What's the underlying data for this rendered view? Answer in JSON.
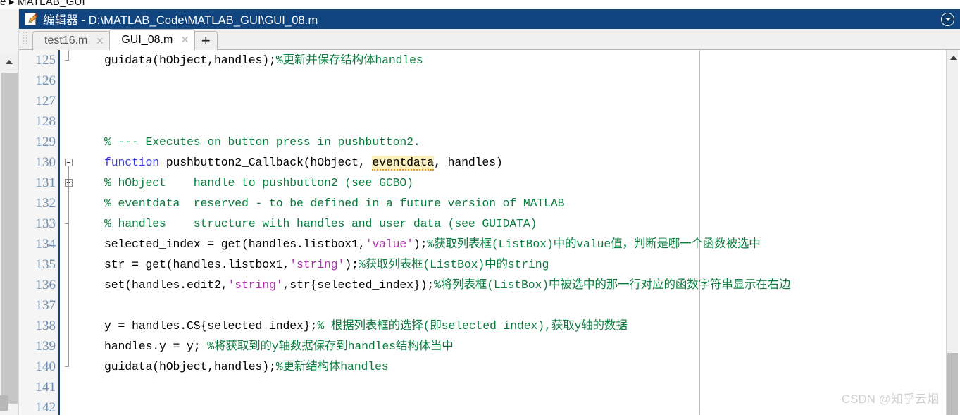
{
  "breadcrumb": {
    "text": "e ▸ MATLAB_GUI"
  },
  "window": {
    "title": "编辑器 - D:\\MATLAB_Code\\MATLAB_GUI\\GUI_08.m",
    "icon": "editor-pencil-icon",
    "dropdown_icon": "chevron-down-circle-icon",
    "titlebar_color": "#11457f"
  },
  "tabs": {
    "items": [
      {
        "label": "test16.m",
        "active": false,
        "close_icon": "✕"
      },
      {
        "label": "GUI_08.m",
        "active": true,
        "close_icon": "✕"
      }
    ],
    "new_tab_label": "+"
  },
  "editor": {
    "first_line_number": 125,
    "column_guide_column": 75,
    "colors": {
      "comment": "#0a7c3d",
      "keyword": "#3d3df5",
      "string": "#b033b0",
      "plain": "#000000",
      "warning_highlight": "#fdf0c0",
      "warning_underline": "#e09a20",
      "linenumber": "#6d8fb5",
      "gutter_bg": "#f5f5f5",
      "gutter_border": "#16487f"
    },
    "lines": [
      {
        "n": 125,
        "fold": "end",
        "tokens": [
          {
            "t": "guidata(hObject,handles);",
            "c": "plain"
          },
          {
            "t": "%更新并保存结构体handles",
            "c": "comment"
          }
        ]
      },
      {
        "n": 126,
        "fold": "none",
        "tokens": []
      },
      {
        "n": 127,
        "fold": "none",
        "tokens": []
      },
      {
        "n": 128,
        "fold": "none",
        "tokens": []
      },
      {
        "n": 129,
        "fold": "none",
        "tokens": [
          {
            "t": "% --- Executes on button press in pushbutton2.",
            "c": "comment"
          }
        ]
      },
      {
        "n": 130,
        "fold": "open",
        "tokens": [
          {
            "t": "function",
            "c": "keyword"
          },
          {
            "t": " pushbutton2_Callback(hObject, ",
            "c": "plain"
          },
          {
            "t": "eventdata",
            "c": "warn"
          },
          {
            "t": ", handles)",
            "c": "plain"
          }
        ]
      },
      {
        "n": 131,
        "fold": "open",
        "tokens": [
          {
            "t": "% hObject    handle to pushbutton2 (see GCBO)",
            "c": "comment"
          }
        ]
      },
      {
        "n": 132,
        "fold": "none",
        "tokens": [
          {
            "t": "% eventdata  reserved - to be defined in a future version of MATLAB",
            "c": "comment"
          }
        ]
      },
      {
        "n": 133,
        "fold": "inner-end",
        "tokens": [
          {
            "t": "% handles    structure with handles and user data (see GUIDATA)",
            "c": "comment"
          }
        ]
      },
      {
        "n": 134,
        "fold": "none",
        "tokens": [
          {
            "t": "selected_index = get(handles.listbox1,",
            "c": "plain"
          },
          {
            "t": "'value'",
            "c": "string"
          },
          {
            "t": ");",
            "c": "plain"
          },
          {
            "t": "%获取列表框(ListBox)中的value值，判断是哪一个函数被选中",
            "c": "comment"
          }
        ]
      },
      {
        "n": 135,
        "fold": "none",
        "tokens": [
          {
            "t": "str = get(handles.listbox1,",
            "c": "plain"
          },
          {
            "t": "'string'",
            "c": "string"
          },
          {
            "t": ");",
            "c": "plain"
          },
          {
            "t": "%获取列表框(ListBox)中的string",
            "c": "comment"
          }
        ]
      },
      {
        "n": 136,
        "fold": "none",
        "tokens": [
          {
            "t": "set(handles.edit2,",
            "c": "plain"
          },
          {
            "t": "'string'",
            "c": "string"
          },
          {
            "t": ",str{selected_index});",
            "c": "plain"
          },
          {
            "t": "%将列表框(ListBox)中被选中的那一行对应的函数字符串显示在右边",
            "c": "comment"
          }
        ]
      },
      {
        "n": 137,
        "fold": "none",
        "tokens": []
      },
      {
        "n": 138,
        "fold": "none",
        "tokens": [
          {
            "t": "y = handles.CS{selected_index};",
            "c": "plain"
          },
          {
            "t": "% 根据列表框的选择(即selected_index),获取y轴的数据",
            "c": "comment"
          }
        ]
      },
      {
        "n": 139,
        "fold": "none",
        "tokens": [
          {
            "t": "handles.y = y; ",
            "c": "plain"
          },
          {
            "t": "%将获取到的y轴数据保存到handles结构体当中",
            "c": "comment"
          }
        ]
      },
      {
        "n": 140,
        "fold": "end",
        "tokens": [
          {
            "t": "guidata(hObject,handles);",
            "c": "plain"
          },
          {
            "t": "%更新结构体handles",
            "c": "comment"
          }
        ]
      },
      {
        "n": 141,
        "fold": "none",
        "tokens": []
      },
      {
        "n": 142,
        "fold": "none",
        "tokens": []
      }
    ]
  },
  "scrollbars": {
    "right_up_icon": "triangle-up-icon",
    "left_up_icon": "chevron-up-icon"
  },
  "watermark": {
    "text": "CSDN @知乎云烟"
  }
}
